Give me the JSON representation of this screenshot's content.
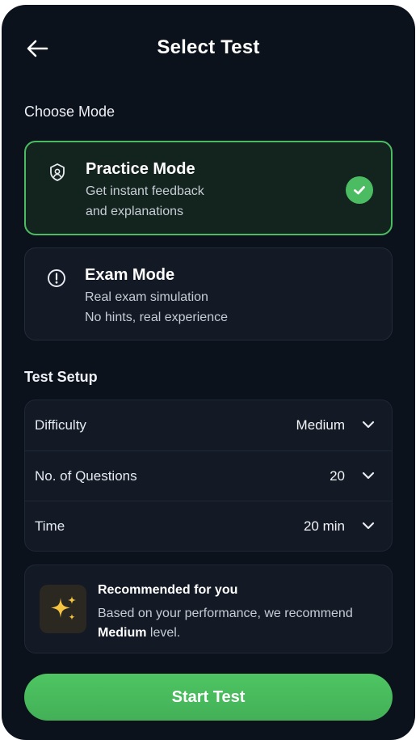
{
  "header": {
    "title": "Select Test",
    "back_icon": "arrow-left-icon"
  },
  "choose_mode": {
    "label": "Choose Mode",
    "modes": [
      {
        "icon": "shield-person-icon",
        "title": "Practice Mode",
        "desc_line1": "Get instant feedback",
        "desc_line2": "and explanations",
        "selected": true
      },
      {
        "icon": "exclamation-circle-icon",
        "title": "Exam Mode",
        "desc_line1": "Real exam simulation",
        "desc_line2": "No hints, real experience",
        "selected": false
      }
    ]
  },
  "test_setup": {
    "label": "Test Setup",
    "rows": [
      {
        "label": "Difficulty",
        "value": "Medium"
      },
      {
        "label": "No. of Questions",
        "value": "20"
      },
      {
        "label": "Time",
        "value": "20 min"
      }
    ]
  },
  "recommendation": {
    "icon": "sparkle-icon",
    "title": "Recommended for you",
    "text_prefix": "Based on your performance, we recommend ",
    "highlight": "Medium",
    "text_suffix": " level."
  },
  "start_button": {
    "label": "Start Test"
  },
  "colors": {
    "background": "#0c121c",
    "card": "#131a25",
    "accent_green": "#4cbc63",
    "sparkle_yellow": "#f5c542"
  }
}
